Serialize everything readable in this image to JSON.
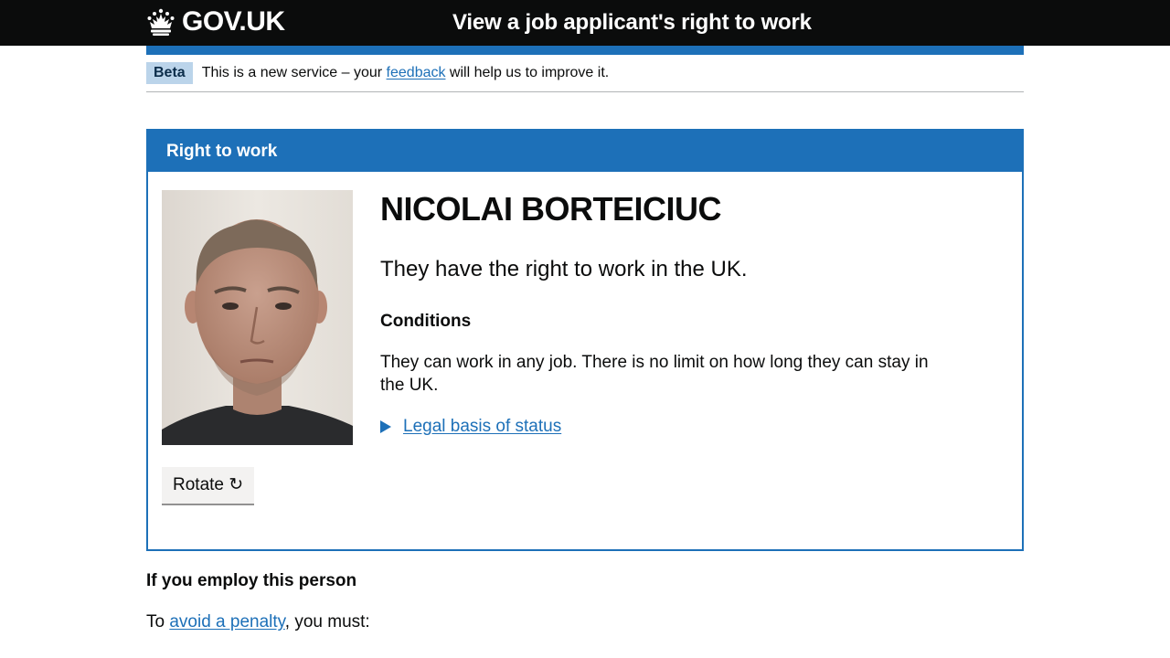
{
  "header": {
    "logo_text": "GOV.UK",
    "service_name": "View a job applicant's right to work"
  },
  "phase_banner": {
    "tag": "Beta",
    "text_before": "This is a new service – your ",
    "link_text": "feedback",
    "text_after": " will help us to improve it."
  },
  "panel": {
    "title": "Right to work",
    "name": "NICOLAI BORTEICIUC",
    "status": "They have the right to work in the UK.",
    "conditions_heading": "Conditions",
    "conditions_text": "They can work in any job. There is no limit on how long they can stay in the UK.",
    "details_label": "Legal basis of status",
    "rotate_button": "Rotate ↻"
  },
  "employ": {
    "heading": "If you employ this person",
    "text_before": "To ",
    "link_text": "avoid a penalty",
    "text_after": ", you must:"
  },
  "colors": {
    "brand_blue": "#1d70b8",
    "header_black": "#0b0c0c",
    "tag_bg": "#bbd4ea"
  }
}
